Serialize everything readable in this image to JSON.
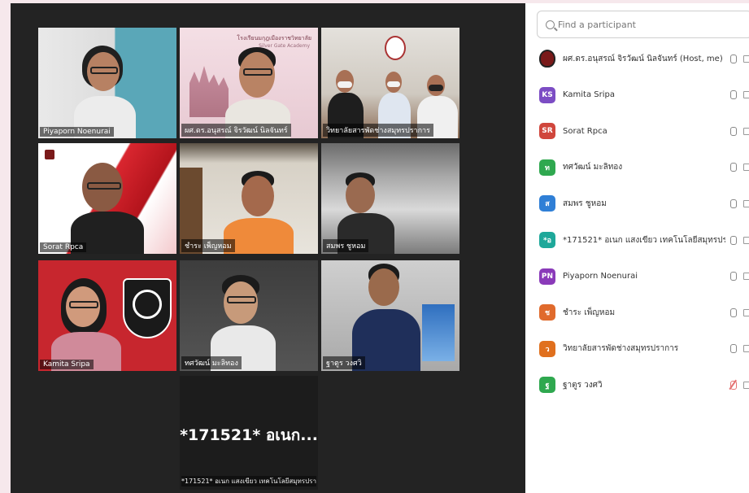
{
  "meeting": {
    "tiles": [
      {
        "name": "Piyaporn Noenurai",
        "active": false
      },
      {
        "name": "ผศ.ดร.อนุสรณ์ จิรวัฒน์ นิลจันทร์",
        "active": false
      },
      {
        "name": "วิทยาลัยสารพัดช่างสมุทรปราการ",
        "active": false
      },
      {
        "name": "Sorat Rpca",
        "active": false
      },
      {
        "name": "ชำระ เพ็ญหอม",
        "active": false
      },
      {
        "name": "สมพร ชูหอม",
        "active": true
      },
      {
        "name": "Kamita Sripa",
        "active": false
      },
      {
        "name": "ทศวัฒน์ มะลิทอง",
        "active": false
      },
      {
        "name": "ฐาตูร วงศวิ",
        "active": false
      }
    ],
    "big_tile": {
      "display": "*171521* อเนก...",
      "caption": "*171521* อเนก แสงเขียว เทคโนโลยีสมุทรปรา..."
    },
    "tile_header_text": {
      "school_banner": "โรงเรียนมกุฎเมืองราชวิทยาลัย",
      "school_banner_sub": "Silver Gate Academy"
    }
  },
  "panel": {
    "search_placeholder": "Find a participant",
    "participants": [
      {
        "name": "ผศ.ดร.อนุสรณ์ จิรวัฒน์ นิลจันทร์ (Host, me)",
        "initials": "",
        "color": "#7a1a1a",
        "is_logo": true,
        "mic_muted": false
      },
      {
        "name": "Kamita Sripa",
        "initials": "KS",
        "color": "#7c4dc4",
        "is_logo": false,
        "mic_muted": false
      },
      {
        "name": "Sorat Rpca",
        "initials": "SR",
        "color": "#d0463c",
        "is_logo": false,
        "mic_muted": false
      },
      {
        "name": "ทศวัฒน์ มะลิทอง",
        "initials": "ท",
        "color": "#2fa84f",
        "is_logo": false,
        "mic_muted": false
      },
      {
        "name": "สมพร ชูหอม",
        "initials": "ส",
        "color": "#2f7fd6",
        "is_logo": false,
        "mic_muted": false
      },
      {
        "name": "*171521* อเนก แสงเขียว เทคโนโลยีสมุทรปราการ(...",
        "initials": "*อ",
        "color": "#1ea89a",
        "is_logo": false,
        "mic_muted": false
      },
      {
        "name": "Piyaporn Noenurai",
        "initials": "PN",
        "color": "#8a3ab9",
        "is_logo": false,
        "mic_muted": false
      },
      {
        "name": "ชำระ เพ็ญหอม",
        "initials": "ช",
        "color": "#e06a2c",
        "is_logo": false,
        "mic_muted": false
      },
      {
        "name": "วิทยาลัยสารพัดช่างสมุทรปราการ",
        "initials": "ว",
        "color": "#e0701e",
        "is_logo": false,
        "mic_muted": false
      },
      {
        "name": "ฐาตูร วงศวิ",
        "initials": "ฐ",
        "color": "#2fa84f",
        "is_logo": false,
        "mic_muted": true
      }
    ]
  }
}
